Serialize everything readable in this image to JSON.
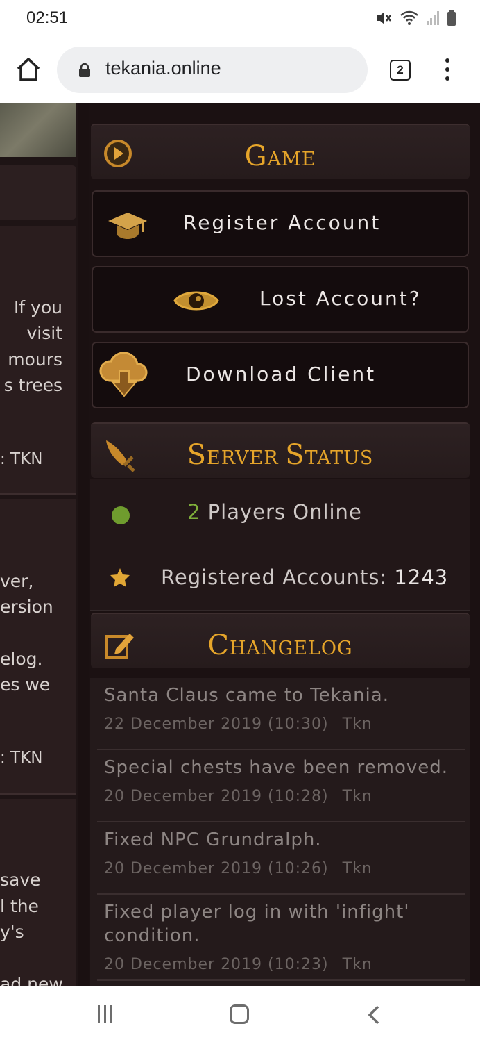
{
  "status_bar": {
    "time": "02:51",
    "icons": [
      "mute-icon",
      "wifi-icon",
      "signal-icon",
      "battery-icon"
    ]
  },
  "browser": {
    "url": "tekania.online",
    "tab_count": "2"
  },
  "left_column": {
    "fragments": [
      "If you",
      "visit",
      "mours",
      "s trees",
      ": TKN",
      "ver,",
      "ersion",
      "elog.",
      "es we",
      ": TKN",
      "save",
      "l the",
      "y's",
      "ad new"
    ]
  },
  "game": {
    "title_cap": "G",
    "title_rest": "AME",
    "register_label": "Register Account",
    "lost_label": "Lost Account?",
    "download_label": "Download Client"
  },
  "server_status": {
    "title_cap1": "S",
    "title_rest1": "ERVER ",
    "title_cap2": "S",
    "title_rest2": "TATUS",
    "players_count": "2",
    "players_text": "Players Online",
    "registered_label": "Registered Accounts:",
    "registered_count": "1243"
  },
  "changelog": {
    "title_cap": "C",
    "title_rest": "HANGELOG",
    "entries": [
      {
        "title": "Santa Claus came to Tekania.",
        "date": "22 December 2019 (10:30)",
        "author": "Tkn"
      },
      {
        "title": "Special chests have been removed.",
        "date": "20 December 2019 (10:28)",
        "author": "Tkn"
      },
      {
        "title": "Fixed NPC Grundralph.",
        "date": "20 December 2019 (10:26)",
        "author": "Tkn"
      },
      {
        "title": "Fixed player log in with 'infight' condition.",
        "date": "20 December 2019 (10:23)",
        "author": "Tkn"
      }
    ]
  },
  "colors": {
    "gold": "#e6a52a",
    "online_dot": "#6f9c2e",
    "background": "#1a1011"
  }
}
